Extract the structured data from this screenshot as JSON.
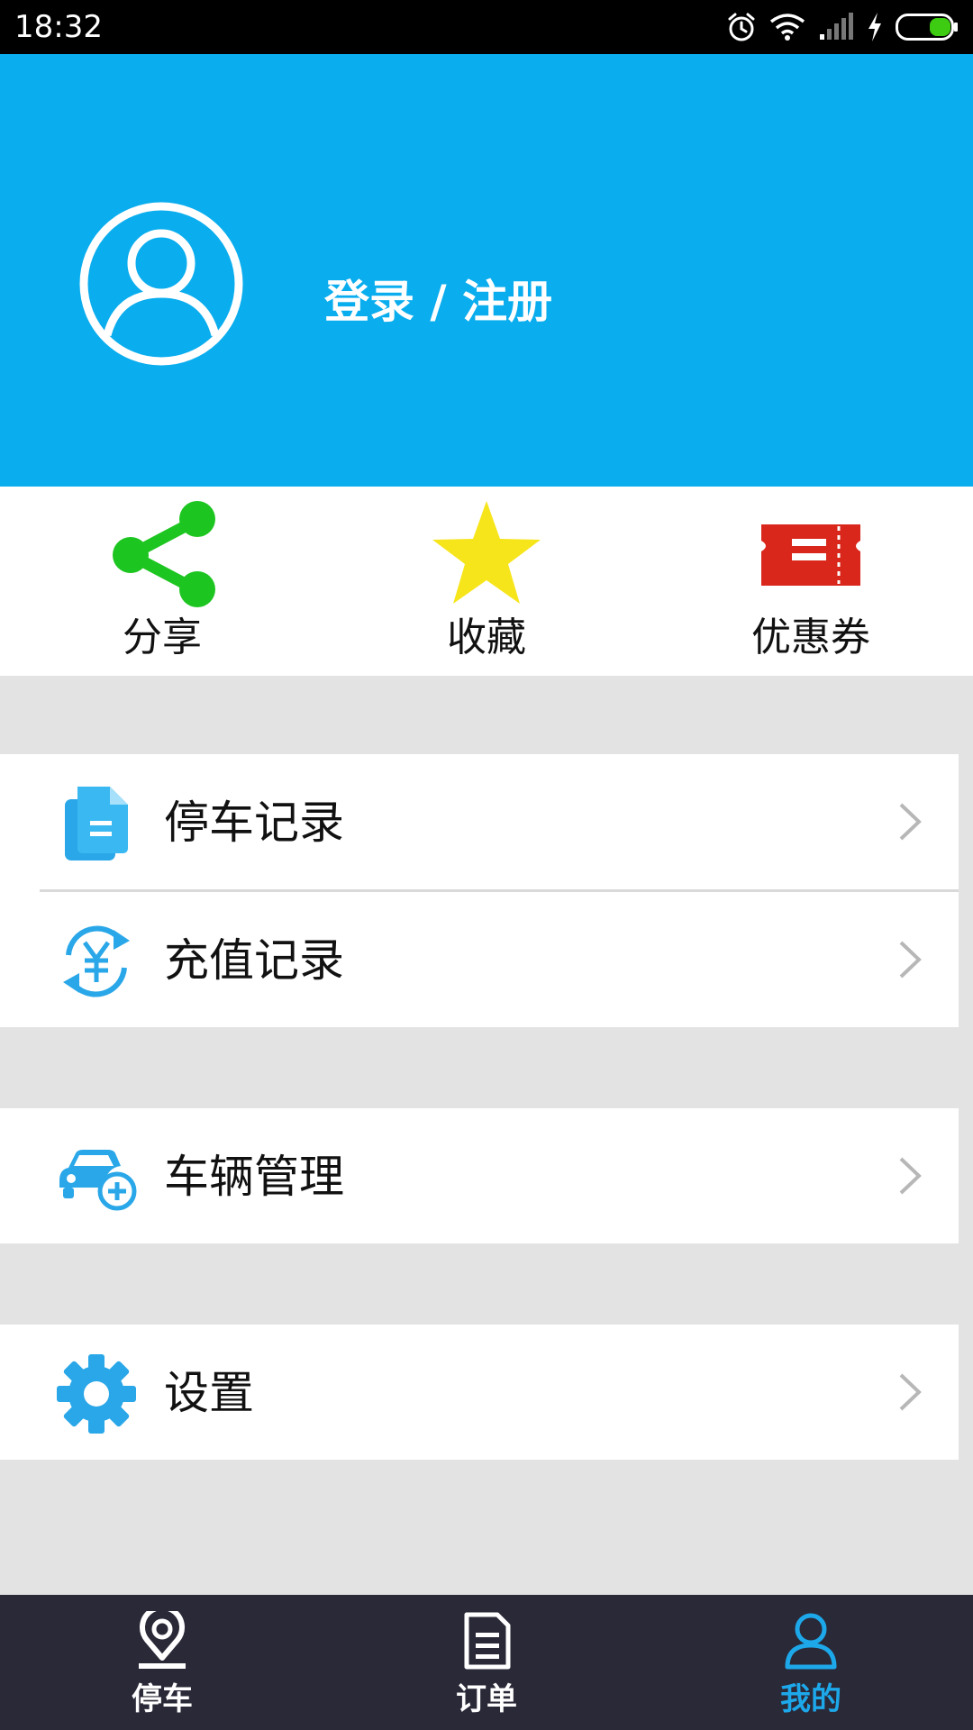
{
  "status_bar": {
    "time": "18:32",
    "icons": [
      "alarm-icon",
      "wifi-icon",
      "signal-icon",
      "charging-icon",
      "battery-icon"
    ],
    "battery_color": "#3dcc12"
  },
  "header": {
    "login_label": "登录 / 注册",
    "background_color": "#0aadee",
    "avatar_icon": "user-avatar-icon"
  },
  "quick_actions": [
    {
      "label": "分享",
      "icon": "share-icon",
      "color": "#1dc520"
    },
    {
      "label": "收藏",
      "icon": "star-icon",
      "color": "#f7e51c"
    },
    {
      "label": "优惠券",
      "icon": "ticket-icon",
      "color": "#d9271c"
    }
  ],
  "menu_groups": [
    {
      "items": [
        {
          "label": "停车记录",
          "icon": "document-icon"
        },
        {
          "label": "充值记录",
          "icon": "yuan-refresh-icon"
        }
      ]
    },
    {
      "items": [
        {
          "label": "车辆管理",
          "icon": "car-add-icon"
        }
      ]
    },
    {
      "items": [
        {
          "label": "设置",
          "icon": "gear-icon"
        }
      ]
    }
  ],
  "bottom_nav": {
    "active": 2,
    "active_color": "#1da8ea",
    "items": [
      {
        "label": "停车",
        "icon": "location-pin-icon"
      },
      {
        "label": "订单",
        "icon": "order-list-icon"
      },
      {
        "label": "我的",
        "icon": "person-icon"
      }
    ]
  }
}
